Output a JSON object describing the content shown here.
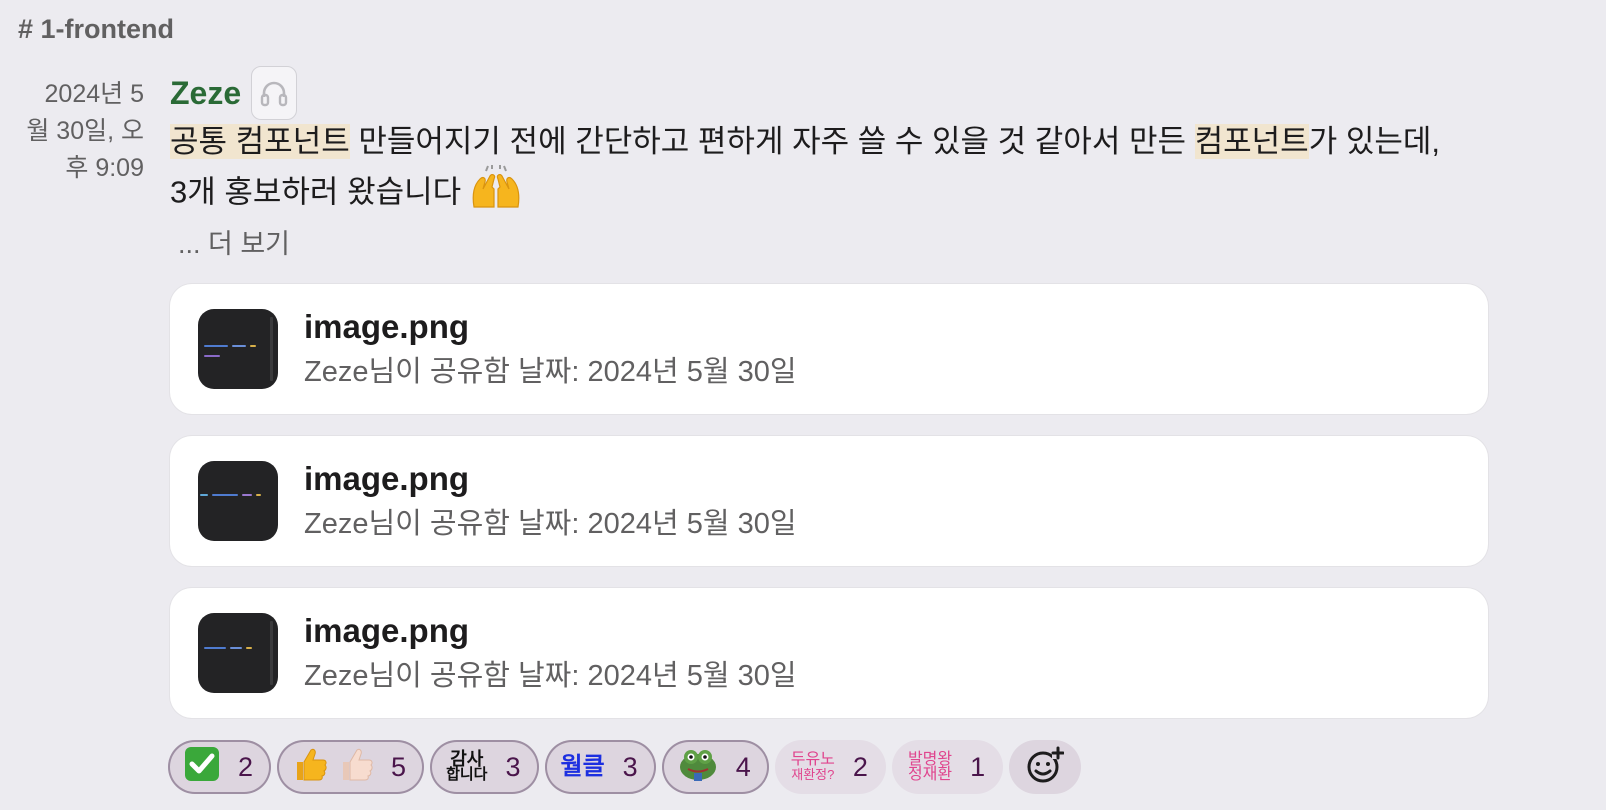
{
  "channel": {
    "name": "# 1-frontend"
  },
  "message": {
    "timestamp_lines": [
      "2024년 5",
      "월 30일, 오",
      "후 9:09"
    ],
    "author": "Zeze",
    "status_icon": "headphones-icon",
    "segments": [
      {
        "text": "공통 컴포넌트",
        "highlight": true
      },
      {
        "text": " 만들어지기 전에 간단하고 편하게 자주 쓸 수 있을 것 같아서 만든 ",
        "highlight": false
      },
      {
        "text": "컴포넌트",
        "highlight": true
      },
      {
        "text": "가 있는데,",
        "highlight": false
      }
    ],
    "line2": "3개 홍보하러 왔습니다 ",
    "line2_emoji": "raising-hands-icon",
    "more_label": "... 더 보기"
  },
  "files": [
    {
      "name": "image.png",
      "meta": "Zeze님이 공유함 날짜: 2024년 5월 30일"
    },
    {
      "name": "image.png",
      "meta": "Zeze님이 공유함 날짜: 2024년 5월 30일"
    },
    {
      "name": "image.png",
      "meta": "Zeze님이 공유함 날짜: 2024년 5월 30일"
    }
  ],
  "reactions": [
    {
      "emoji": "white-check-mark-icon",
      "count": "2"
    },
    {
      "emoji": "thumbs-up-icon",
      "count": "5"
    },
    {
      "emoji": "text-emoji",
      "text_top": "감사",
      "text_bottom": "합니다",
      "count": "3"
    },
    {
      "emoji": "text-emoji",
      "text_top": "월클",
      "count": "3"
    },
    {
      "emoji": "frog-icon",
      "count": "4"
    },
    {
      "emoji": "text-emoji",
      "text_top": "두유노",
      "text_bottom": "재환정?",
      "count": "2"
    },
    {
      "emoji": "text-emoji",
      "text_top": "발명왕",
      "text_bottom": "정재환",
      "count": "1"
    }
  ],
  "colors": {
    "background": "#ecebf0",
    "author": "#2a6a36",
    "highlight": "#f1e5cf",
    "reaction_text": "#4a154b"
  }
}
